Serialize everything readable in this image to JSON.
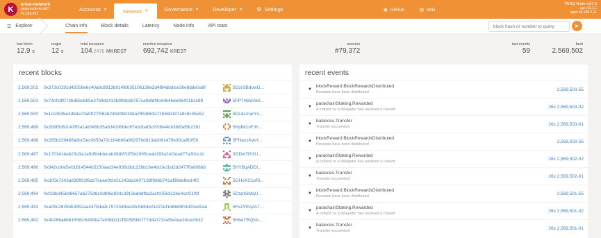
{
  "header": {
    "chain_name": "krest-network",
    "node_name": "peaq-node-krest/7",
    "block_number": "#2,569,502",
    "logo_letter": "K",
    "nav": [
      {
        "label": "Accounts"
      },
      {
        "label": "Network"
      },
      {
        "label": "Governance"
      },
      {
        "label": "Developer"
      },
      {
        "label": "Settings"
      }
    ],
    "github": "GitHub",
    "wiki": "Wiki",
    "version_node": "PEAQ Node v3.0.0",
    "version_api": "api v11.1.1",
    "version_apps": "apps v0.138.2-11"
  },
  "subnav": {
    "explorer": "Explorer",
    "tabs": [
      "Chain info",
      "Block details",
      "Latency",
      "Node info",
      "API stats"
    ],
    "search_placeholder": "block hash or number to query",
    "go_icon": "play-icon"
  },
  "summary": {
    "last_block_label": "last block",
    "last_block_value": "12.9",
    "last_block_unit": "s",
    "target_label": "target",
    "target_value": "12",
    "target_unit": "s",
    "total_issuance_label": "total issuance",
    "total_issuance_main": "104",
    "total_issuance_dim": ".2476",
    "total_issuance_unit": "MKREST",
    "inactive_label": "inactive issuance",
    "inactive_value": "692,742",
    "inactive_unit": "KREST",
    "session_label": "session",
    "session_value": "#79,372",
    "last_events_label": "last events",
    "last_events_value": "59",
    "best_label": "best",
    "best_value": "2,569,502"
  },
  "recent_blocks": {
    "title": "recent blocks",
    "rows": [
      {
        "num": "2,569,502",
        "hash": "0x373c0191d45059e6c40a9c9913b914f8035106138e2d4f84dbdice36e8dde0a8f",
        "author": "5GzrSBdowG..."
      },
      {
        "num": "2,569,501",
        "hash": "0x74cf18f073bd56c865e37b9d1413b99bb38757ca96fdf4c64b46de96401b2c99",
        "author": "5FP74MaVa4..."
      },
      {
        "num": "2,569,500",
        "hash": "0x1ccd535e4db4e74a0927f06cb24fef4b919da2953b63c72b5bb187a8c8c35e52",
        "author": "5DLdLmarYs..."
      },
      {
        "num": "2,569,499",
        "hash": "0x2b9f5062c43ff3a1a6345b35a634190bbc67eb2baf3c97db44cb388faf5b22b1",
        "author": "5HjdM1nFJh..."
      },
      {
        "num": "2,569,498",
        "hash": "0x265b23946ffa8bc5ec0650a72c104866a962976d813ab081479e30caf83f56",
        "author": "5FHaxzKvkY..."
      },
      {
        "num": "2,569,497",
        "hash": "0x1703414a623d3a1a5d5b4decab3fdbf7d75b2005ceab393a2ef2ead77a30cc2c",
        "author": "5GDxt7Pi3U..."
      },
      {
        "num": "2,569,496",
        "hash": "0x942cd0e5e01814544b5150aad34e936c8dc239b16e4bc0e1bd2d2477ffa808b8",
        "author": "5HYBqADDt..."
      },
      {
        "num": "2,569,495",
        "hash": "0xd05e7243a836ff31f6dd7ceae0f2e51243da1607168f9d6b741af88defbe14f2",
        "author": "5GHoXC1eRi..."
      },
      {
        "num": "2,569,494",
        "hash": "0xf2db3458d8657ab275d8c0dbf6e834c3913edddfba2acfc0563c2be4cef21f9f",
        "author": "5Ctqrk6MqU..."
      },
      {
        "num": "2,569,493",
        "hash": "0xa05c2835bb3952aa447bda9c75723d9de28c9884e01d72ef1d68d903d03a40ae",
        "author": "5FxZVEq2A7..."
      },
      {
        "num": "2,569,492",
        "hash": "0x4b266a6bb1f090c5499ba7e09bb112f50395bb777dde372cef5edae24cecf632",
        "author": "5HbeTRQhA..."
      }
    ],
    "identicon_colors": [
      "#c9a94a",
      "#8a6bc2",
      "#5a9a4c",
      "#d08040",
      "#6a8fc4",
      "#c45a8a",
      "#4aa8a0",
      "#b07a40",
      "#7a7a7a",
      "#9ac44a",
      "#c4704a"
    ]
  },
  "recent_events": {
    "title": "recent events",
    "rows": [
      {
        "title": "blockReward.BlockRewardsDistributed",
        "desc": "Rewards have been distributed",
        "link": "2,569,503-55"
      },
      {
        "title": "parachainStaking.Rewarded",
        "desc": "A collator or a delegator has received a reward",
        "link": "26x 2,569,503-02"
      },
      {
        "title": "balances.Transfer",
        "desc": "Transfer succeeded",
        "link": "26x 2,569,503-01"
      },
      {
        "title": "blockReward.BlockRewardsDistributed",
        "desc": "Rewards have been distributed",
        "link": "2,569,502-55"
      },
      {
        "title": "parachainStaking.Rewarded",
        "desc": "A collator or a delegator has received a reward",
        "link": "26x 2,569,502-02"
      },
      {
        "title": "balances.Transfer",
        "desc": "Transfer succeeded",
        "link": "26x 2,569,502-01"
      },
      {
        "title": "blockReward.BlockRewardsDistributed",
        "desc": "Rewards have been distributed",
        "link": "2,569,501-55"
      },
      {
        "title": "parachainStaking.Rewarded",
        "desc": "A collator or a delegator has received a reward",
        "link": "26x 2,569,501-02"
      },
      {
        "title": "balances.Transfer",
        "desc": "Transfer succeeded",
        "link": "26x 2,569,501-01"
      }
    ]
  }
}
